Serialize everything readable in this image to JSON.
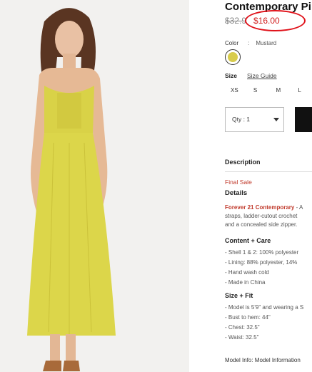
{
  "product": {
    "title": "Contemporary Pi",
    "old_price": "$32.9",
    "new_price": "$16.00",
    "color_label": "Color",
    "color_sep": ":",
    "color_value": "Mustard",
    "swatch_color": "#d8cc4d",
    "size_label": "Size",
    "size_guide": "Size Guide",
    "sizes": [
      "XS",
      "S",
      "M",
      "L"
    ],
    "qty_label": "Qty : 1",
    "description_heading": "Description",
    "final_sale": "Final Sale",
    "details_heading": "Details",
    "details_brand": "Forever 21 Contemporary",
    "details_line1_rest": " - A",
    "details_line2": "straps, ladder-cutout crochet",
    "details_line3": "and a concealed side zipper.",
    "content_heading": "Content + Care",
    "content_items": [
      "- Shell 1 & 2: 100% polyester",
      "- Lining: 88% polyester, 14%",
      "- Hand wash cold",
      "- Made in China"
    ],
    "size_fit_heading": "Size + Fit",
    "size_fit_items": [
      "- Model is 5'9\" and wearing a S",
      "- Bust to hem: 44\"",
      "- Chest: 32.5\"",
      "- Waist: 32.5\""
    ],
    "model_info": "Model Info: Model Information"
  },
  "colors": {
    "accent_red": "#e0131b",
    "sale_red": "#d11c1c",
    "dress_yellow": "#dcd64a",
    "button_black": "#111111"
  }
}
